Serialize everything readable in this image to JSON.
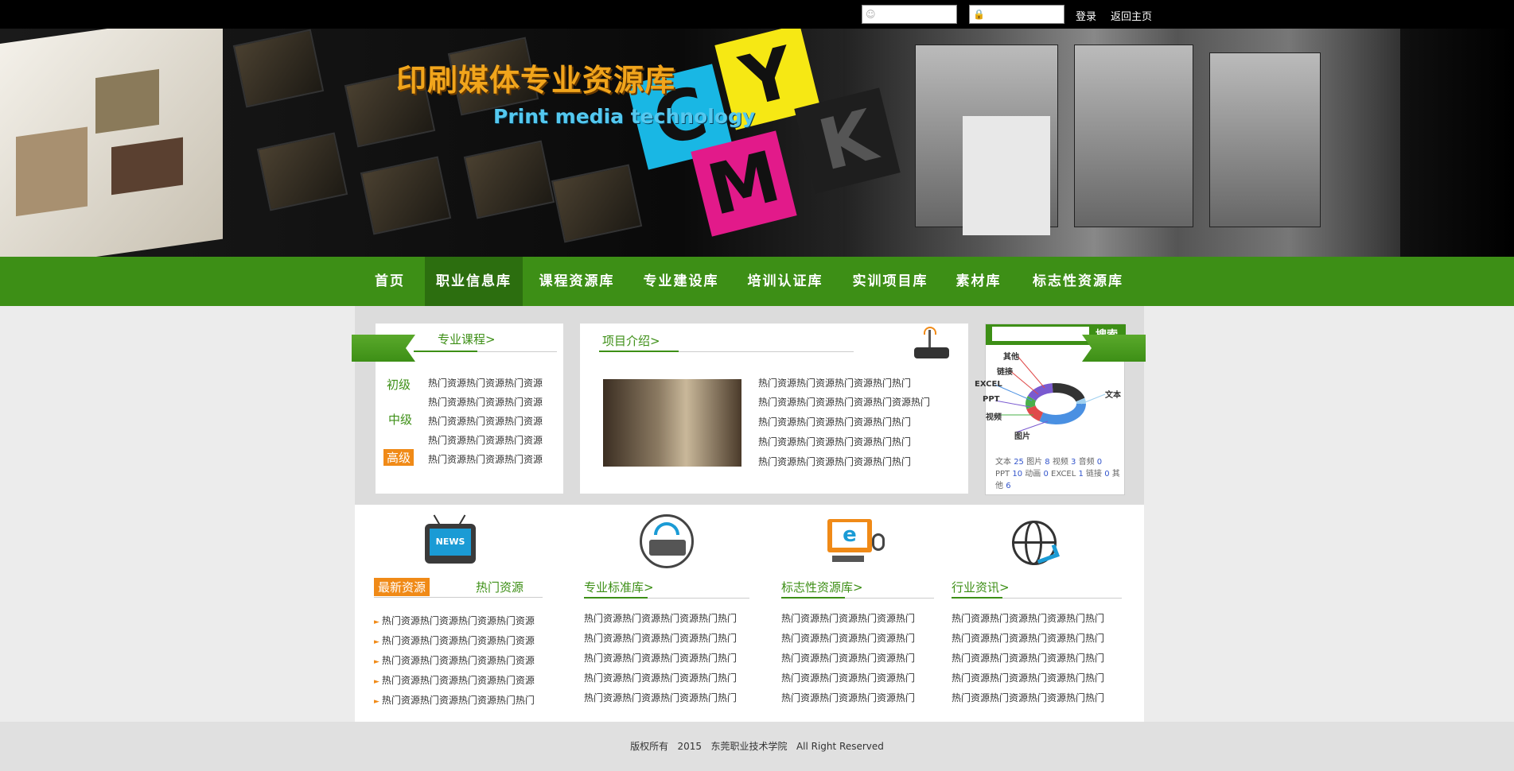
{
  "topbar": {
    "username_placeholder": "",
    "password_placeholder": "",
    "login_label": "登录",
    "home_label": "返回主页"
  },
  "banner": {
    "title": "印刷媒体专业资源库",
    "subtitle": "Print media technology",
    "cubes": [
      "C",
      "Y",
      "M",
      "K"
    ]
  },
  "nav": {
    "items": [
      "首页",
      "职业信息库",
      "课程资源库",
      "专业建设库",
      "培训认证库",
      "实训项目库",
      "素材库",
      "标志性资源库"
    ],
    "active_index": 1
  },
  "courses": {
    "title": "专业课程>",
    "levels": [
      "初级",
      "中级",
      "高级"
    ],
    "active_level": 2,
    "rows": [
      "热门资源热门资源热门资源",
      "热门资源热门资源热门资源",
      "热门资源热门资源热门资源",
      "热门资源热门资源热门资源",
      "热门资源热门资源热门资源"
    ]
  },
  "project": {
    "title": "项目介绍>",
    "rows": [
      "热门资源热门资源热门资源热门热门",
      "热门资源热门资源热门资源热门资源热门",
      "热门资源热门资源热门资源热门热门",
      "热门资源热门资源热门资源热门热门",
      "热门资源热门资源热门资源热门热门"
    ]
  },
  "search": {
    "button_label": "搜索",
    "input_value": "",
    "chart_labels": [
      "其他",
      "链接",
      "EXCEL",
      "PPT",
      "视频",
      "图片",
      "文本"
    ],
    "stats_line1_a": "文本 ",
    "stats_text": "25",
    "stats_line1_b": " 图片 ",
    "stats_image": "8",
    "stats_line1_c": " 视频 ",
    "stats_video": "3",
    "stats_line1_d": " 音频 ",
    "stats_audio": "0",
    "stats_line2_a": "PPT ",
    "stats_ppt": "10",
    "stats_line2_b": " 动画 ",
    "stats_anim": "0",
    "stats_line2_c": " EXCEL ",
    "stats_excel": "1",
    "stats_line2_d": " 链接 ",
    "stats_link": "0",
    "stats_line2_e": " 其",
    "stats_line3_a": "他 ",
    "stats_other": "6",
    "chart_colors": [
      "#4a90e2",
      "#e04a4a",
      "#4ab04a",
      "#7a5ad0",
      "#333333",
      "#9fd0f0"
    ]
  },
  "latest": {
    "tab_latest": "最新资源",
    "tab_hot": "热门资源",
    "rows": [
      "热门资源热门资源热门资源热门资源",
      "热门资源热门资源热门资源热门资源",
      "热门资源热门资源热门资源热门资源",
      "热门资源热门资源热门资源热门资源",
      "热门资源热门资源热门资源热门热门"
    ]
  },
  "standards": {
    "title": "专业标准库>",
    "rows": [
      "热门资源热门资源热门资源热门热门",
      "热门资源热门资源热门资源热门热门",
      "热门资源热门资源热门资源热门热门",
      "热门资源热门资源热门资源热门热门",
      "热门资源热门资源热门资源热门热门"
    ]
  },
  "landmark": {
    "title": "标志性资源库>",
    "rows": [
      "热门资源热门资源热门资源热门",
      "热门资源热门资源热门资源热门",
      "热门资源热门资源热门资源热门",
      "热门资源热门资源热门资源热门",
      "热门资源热门资源热门资源热门"
    ]
  },
  "industry": {
    "title": "行业资讯>",
    "rows": [
      "热门资源热门资源热门资源热门热门",
      "热门资源热门资源热门资源热门热门",
      "热门资源热门资源热门资源热门热门",
      "热门资源热门资源热门资源热门热门",
      "热门资源热门资源热门资源热门热门"
    ]
  },
  "footer": {
    "text": "版权所有   2015   东莞职业技术学院   All Right Reserved"
  },
  "colors": {
    "brand_green": "#3d8f16",
    "nav_active": "#2c6e0f",
    "accent_orange": "#f08a17"
  }
}
